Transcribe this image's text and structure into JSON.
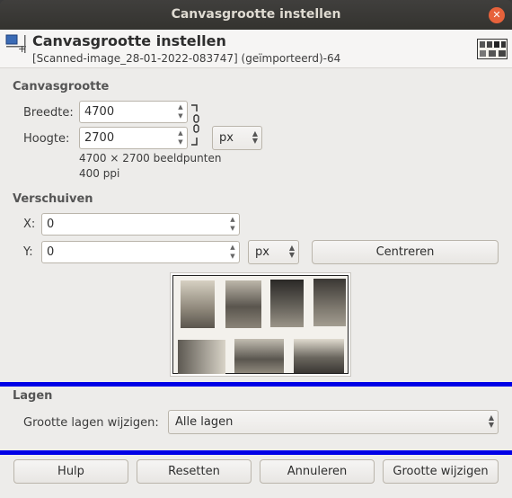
{
  "window": {
    "title": "Canvasgrootte instellen"
  },
  "header": {
    "title": "Canvasgrootte instellen",
    "subtitle": "[Scanned-image_28-01-2022-083747] (geïmporteerd)-64"
  },
  "canvas_size": {
    "section_label": "Canvasgrootte",
    "width_label": "Breedte:",
    "width_value": "4700",
    "height_label": "Hoogte:",
    "height_value": "2700",
    "unit": "px",
    "info_pixels": "4700 × 2700 beeldpunten",
    "info_ppi": "400 ppi"
  },
  "offset": {
    "section_label": "Verschuiven",
    "x_label": "X:",
    "x_value": "0",
    "y_label": "Y:",
    "y_value": "0",
    "unit": "px",
    "center_button": "Centreren"
  },
  "layers": {
    "section_label": "Lagen",
    "resize_label": "Grootte lagen wijzigen:",
    "resize_value": "Alle lagen"
  },
  "buttons": {
    "help": "Hulp",
    "reset": "Resetten",
    "cancel": "Annuleren",
    "apply": "Grootte wijzigen"
  },
  "colors": {
    "highlight_bar": "#0000e6",
    "close_button": "#e7623b"
  }
}
